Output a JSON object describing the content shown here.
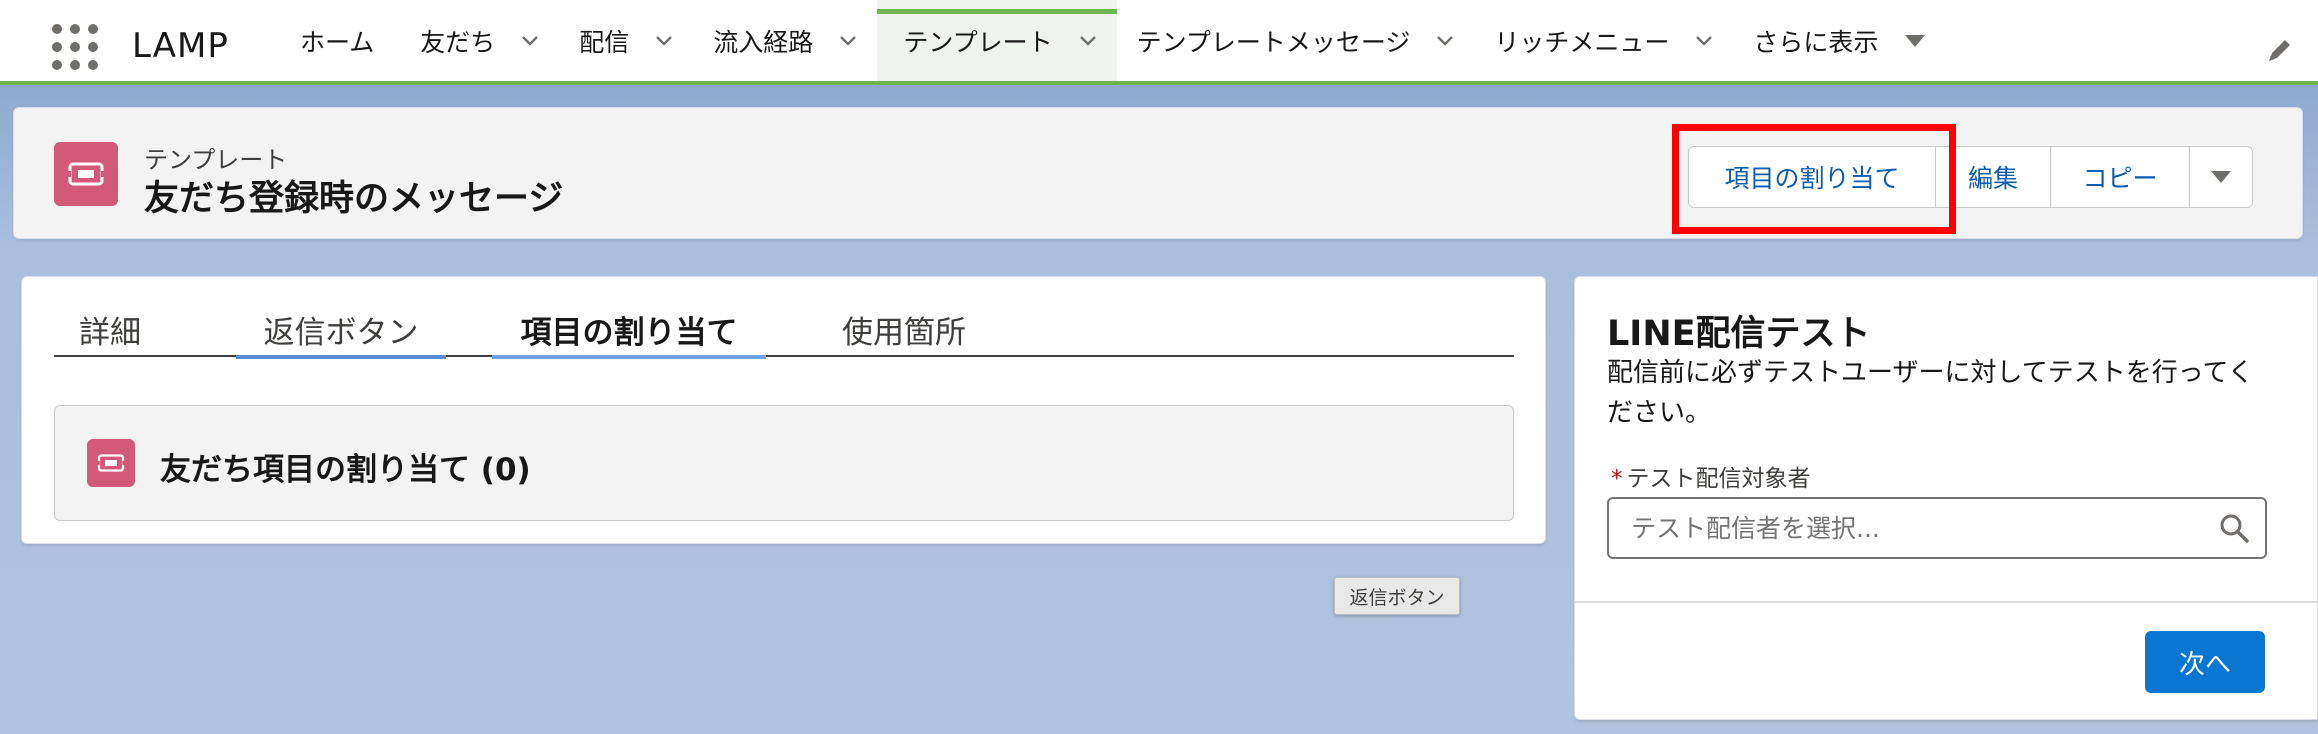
{
  "app": {
    "name": "LAMP"
  },
  "nav": {
    "items": [
      {
        "label": "ホーム",
        "has_menu": false,
        "active": false
      },
      {
        "label": "友だち",
        "has_menu": true,
        "active": false
      },
      {
        "label": "配信",
        "has_menu": true,
        "active": false
      },
      {
        "label": "流入経路",
        "has_menu": true,
        "active": false
      },
      {
        "label": "テンプレート",
        "has_menu": true,
        "active": true
      },
      {
        "label": "テンプレートメッセージ",
        "has_menu": true,
        "active": false
      },
      {
        "label": "リッチメニュー",
        "has_menu": true,
        "active": false
      },
      {
        "label": "さらに表示",
        "has_menu": true,
        "active": false
      }
    ]
  },
  "record": {
    "object_type": "テンプレート",
    "title": "友だち登録時のメッセージ",
    "actions": [
      {
        "label": "項目の割り当て",
        "highlighted": true
      },
      {
        "label": "編集"
      },
      {
        "label": "コピー"
      }
    ]
  },
  "tabs": [
    {
      "label": "詳細",
      "active": false
    },
    {
      "label": "返信ボタン",
      "active": false
    },
    {
      "label": "項目の割り当て",
      "active": true
    },
    {
      "label": "使用箇所",
      "active": false
    }
  ],
  "related_list": {
    "title": "友だち項目の割り当て (0)"
  },
  "tooltip": {
    "text": "返信ボタン"
  },
  "side_panel": {
    "title": "LINE配信テスト",
    "description": "配信前に必ずテストユーザーに対してテストを行ってください。",
    "field_required_mark": "*",
    "field_label": "テスト配信対象者",
    "search_placeholder": "テスト配信者を選択...",
    "search_value": "",
    "next_button": "次へ"
  },
  "colors": {
    "nav_accent": "#6cb54f",
    "brand_blue": "#0b5cab",
    "primary_button": "#0b76d1",
    "record_icon": "#d3597a",
    "highlight_red": "#ff0000"
  },
  "icons": {
    "app_launcher": "waffle-icon",
    "chevron": "chevron-down-icon",
    "edit": "pencil-icon",
    "record": "ticket-icon",
    "search": "search-icon",
    "dropdown": "caret-down-icon"
  }
}
